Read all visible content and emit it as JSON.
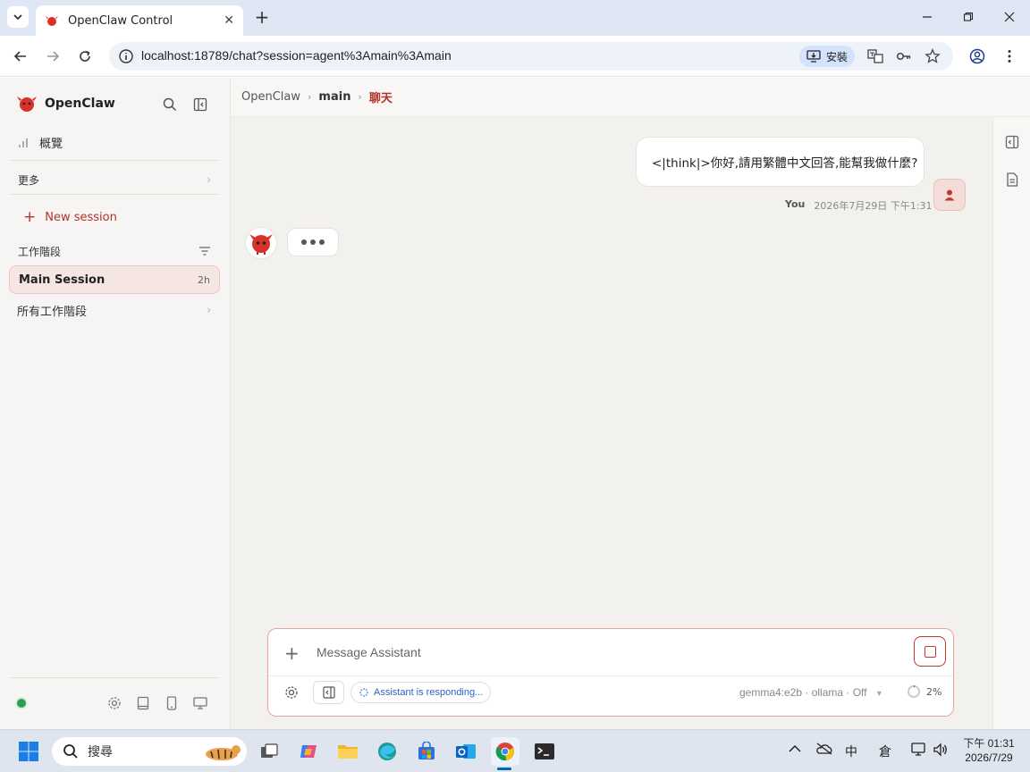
{
  "browser": {
    "tab_title": "OpenClaw Control",
    "tab_close": "✕",
    "new_tab": "+",
    "url": "localhost:18789/chat?session=agent%3Amain%3Amain",
    "install_label": "安裝"
  },
  "sidebar": {
    "brand": "OpenClaw",
    "overview": "概覽",
    "more": "更多",
    "new_session": "New session",
    "sessions_header": "工作階段",
    "sessions": [
      {
        "name": "Main Session",
        "age": "2h"
      }
    ],
    "all_sessions": "所有工作階段",
    "status_color": "#2e9e4f"
  },
  "breadcrumb": {
    "root": "OpenClaw",
    "agent": "main",
    "page": "聊天"
  },
  "chat": {
    "messages": [
      {
        "role": "user",
        "text": "<|think|>你好,請用繁體中文回答,能幫我做什麼?",
        "sender": "You",
        "timestamp": "2026年7月29日 下午1:31"
      }
    ],
    "assistant_typing": true
  },
  "composer": {
    "placeholder": "Message Assistant",
    "status": "Assistant is responding...",
    "model": "gemma4:e2b · ollama · Off",
    "context_usage": "2%"
  },
  "taskbar": {
    "search_placeholder": "搜尋",
    "ime": "中",
    "ime2": "倉",
    "time": "下午 01:31",
    "date": "2026/7/29"
  },
  "colors": {
    "accent": "#b3322a",
    "sidebar_bg": "#f6f5f3",
    "main_bg": "#f3f1ee"
  }
}
